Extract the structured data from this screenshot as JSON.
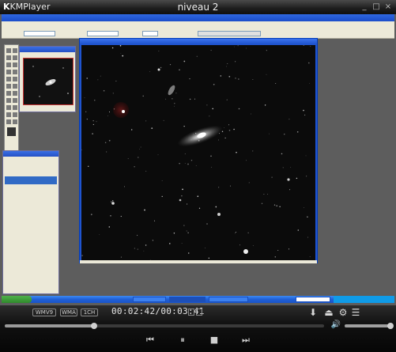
{
  "app": {
    "logo_text": "KMPlayer",
    "window_title": "niveau 2",
    "window_buttons": {
      "minimize": "_",
      "maximize": "□",
      "close": "×"
    }
  },
  "controls": {
    "format_badges": [
      "WMV9",
      "WMA",
      "1CH"
    ],
    "current_time": "00:02:42",
    "separator": "/",
    "total_time": "00:03:41",
    "seek_progress": 0.28,
    "volume_level": 0.95,
    "icons": [
      "download-icon",
      "eject-icon",
      "settings-gear-icon",
      "playlist-icon",
      "volume-icon",
      "previous-icon",
      "pause-icon",
      "stop-icon",
      "next-icon"
    ],
    "glyphs": {
      "download": "⬇",
      "eject": "⏏",
      "gear": "⚙",
      "playlist": "☰",
      "volume": "🔊",
      "prev": "⏮",
      "pause": "⏸",
      "stop": "■",
      "next": "⏭"
    }
  },
  "colors": {
    "accent_blue": "#1f54cf",
    "taskbar_blue": "#1f5fd6",
    "start_green": "#2f8a2b",
    "control_bg": "#111111"
  }
}
